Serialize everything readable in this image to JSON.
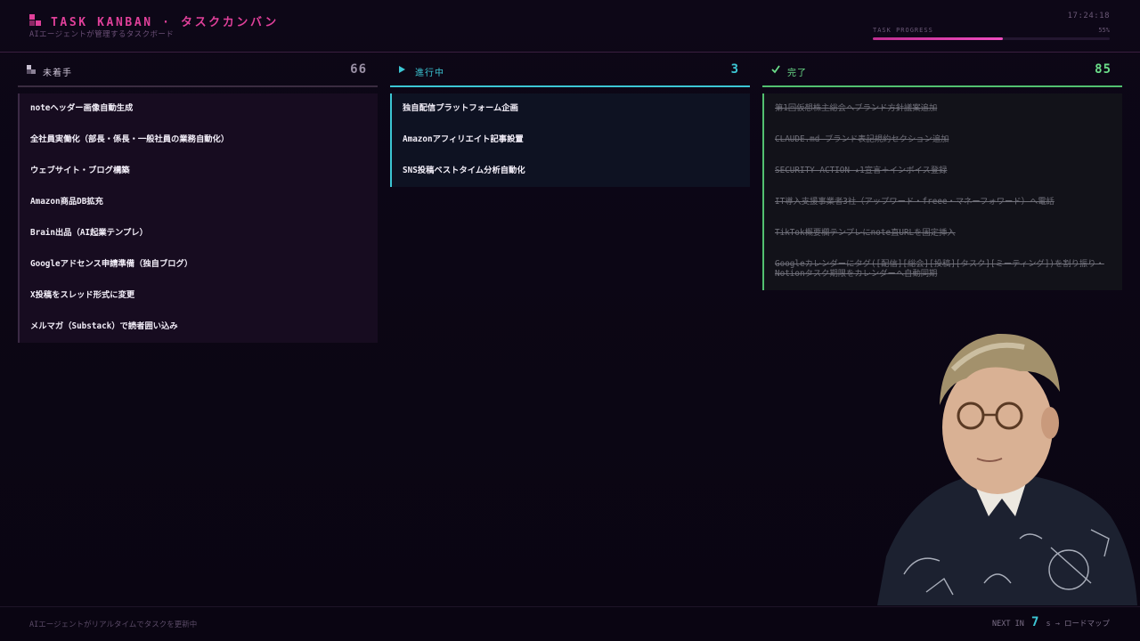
{
  "header": {
    "title": "TASK KANBAN · タスクカンバン",
    "subtitle": "AIエージェントが管理するタスクボード",
    "clock": "17:24:18",
    "progress_label": "TASK PROGRESS",
    "progress_text": "55%",
    "progress_value": 0.55,
    "accent_color": "#e0409a"
  },
  "columns": {
    "todo": {
      "icon": "stacked-squares-icon",
      "title": "未着手",
      "count": "66",
      "color": "#8a8095",
      "cards": [
        "noteヘッダー画像自動生成",
        "全社員実働化（部長・係長・一般社員の業務自動化）",
        "ウェブサイト・ブログ構築",
        "Amazon商品DB拡充",
        "Brain出品（AI起業テンプレ）",
        "Googleアドセンス申請準備（独自ブログ）",
        "X投稿をスレッド形式に変更",
        "メルマガ（Substack）で読者囲い込み"
      ]
    },
    "in_progress": {
      "icon": "play-triangle-icon",
      "title": "進行中",
      "count": "3",
      "color": "#3cc6d4",
      "cards": [
        "独自配信プラットフォーム企画",
        "Amazonアフィリエイト記事設置",
        "SNS投稿ベストタイム分析自動化"
      ]
    },
    "done": {
      "icon": "check-icon",
      "title": "完了",
      "count": "85",
      "color": "#6adc88",
      "cards": [
        "第1回仮想株主総会へブランド方針議案追加",
        "CLAUDE.md ブランド表記規約セクション追加",
        "SECURITY ACTION ★1宣言＋インボイス登録",
        "IT導入支援事業者3社（アップワード・freee・マネーフォワード）へ電話",
        "TikTok概要欄テンプレにnote直URLを固定挿入",
        "Googleカレンダーにタグ([配信][総会][投稿][タスク][ミーティング])を割り振り・Notionタスク期限をカレンダーへ自動同期"
      ]
    }
  },
  "footer": {
    "message": "AIエージェントがリアルタイムでタスクを更新中",
    "next_prefix": "NEXT IN",
    "next_seconds": "7",
    "next_suffix": "s → ロードマップ"
  },
  "webcam": {
    "description_icon": "presenter-webcam-icon"
  }
}
